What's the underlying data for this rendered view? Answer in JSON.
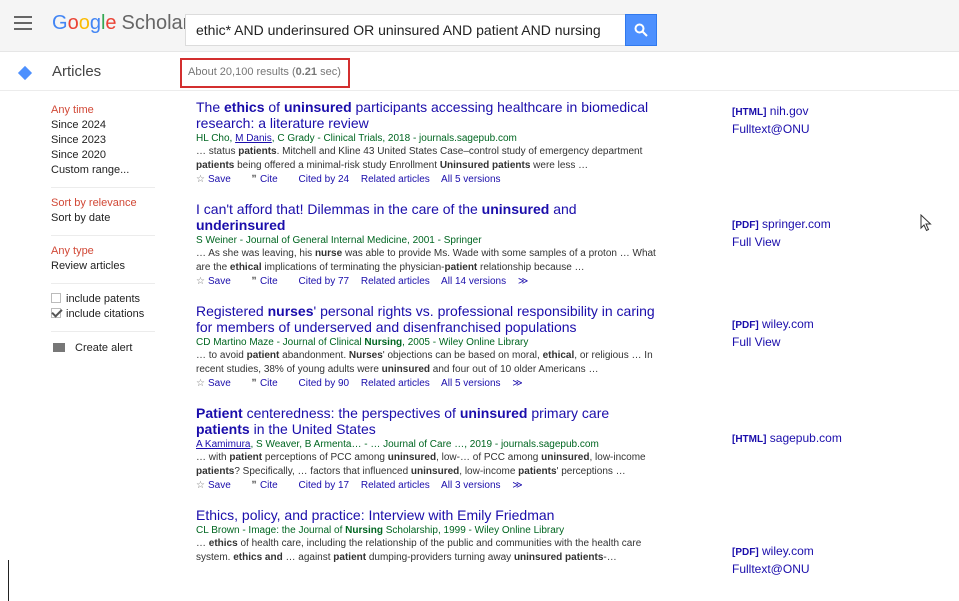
{
  "header": {
    "logo_letters": [
      "G",
      "o",
      "o",
      "g",
      "l",
      "e"
    ],
    "logo_word2": "Scholar",
    "search_value": "ethic* AND underinsured OR uninsured AND patient AND nursing"
  },
  "subbar": {
    "section": "Articles",
    "stats_prefix": "About 20,100 results (",
    "stats_time": "0.21",
    "stats_suffix": " sec)"
  },
  "sidebar": {
    "time": [
      "Any time",
      "Since 2024",
      "Since 2023",
      "Since 2020",
      "Custom range..."
    ],
    "sort": [
      "Sort by relevance",
      "Sort by date"
    ],
    "type": [
      "Any type",
      "Review articles"
    ],
    "include_patents": "include patents",
    "include_citations": "include citations",
    "create_alert": "Create alert"
  },
  "results": [
    {
      "title_html": "The <b>ethics</b> of <b>uninsured</b> participants accessing healthcare in biomedical research: a literature review",
      "authors_html": "HL Cho, <u>M Danis</u>, C Grady - Clinical Trials, 2018 - journals.sagepub.com",
      "snippet_html": "… status <b>patients</b>. Mitchell and Kline 43 United States Case–control study of emergency department <b>patients</b> being offered a minimal-risk study Enrollment <b>Uninsured patients</b> were less …",
      "save": "Save",
      "cite": "Cite",
      "cited_by": "Cited by 24",
      "related": "Related articles",
      "versions": "All 5 versions",
      "extra": ""
    },
    {
      "title_html": "I can't afford that! Dilemmas in the care of the <b>uninsured</b> and <b>underinsured</b>",
      "authors_html": "S Weiner - Journal of General Internal Medicine, 2001 - Springer",
      "snippet_html": "… As she was leaving, his <b>nurse</b> was able to provide Ms. Wade with some samples of a proton … What are the <b>ethical</b> implications of terminating the physician-<b>patient</b> relationship because …",
      "save": "Save",
      "cite": "Cite",
      "cited_by": "Cited by 77",
      "related": "Related articles",
      "versions": "All 14 versions",
      "extra": "≫"
    },
    {
      "title_html": "Registered <b>nurses</b>' personal rights vs. professional responsibility in caring for members of underserved and disenfranchised populations",
      "authors_html": "CD Martino Maze - Journal of Clinical <b>Nursing</b>, 2005 - Wiley Online Library",
      "snippet_html": "… to avoid <b>patient</b> abandonment. <b>Nurses</b>' objections can be based on moral, <b>ethical</b>, or religious … In recent studies, 38% of young adults were <b>uninsured</b> and four out of 10 older Americans …",
      "save": "Save",
      "cite": "Cite",
      "cited_by": "Cited by 90",
      "related": "Related articles",
      "versions": "All 5 versions",
      "extra": "≫"
    },
    {
      "title_html": "<b>Patient</b> centeredness: the perspectives of <b>uninsured</b> primary care <b>patients</b> in the United States",
      "authors_html": "<u>A Kamimura</u>, S Weaver, B Armenta… - … Journal of Care …, 2019 - journals.sagepub.com",
      "snippet_html": "… with <b>patient</b> perceptions of PCC among <b>uninsured</b>, low-… of PCC among <b>uninsured</b>, low-income <b>patients</b>? Specifically, … factors that influenced <b>uninsured</b>, low-income <b>patients</b>' perceptions …",
      "save": "Save",
      "cite": "Cite",
      "cited_by": "Cited by 17",
      "related": "Related articles",
      "versions": "All 3 versions",
      "extra": "≫"
    },
    {
      "title_html": "Ethics, policy, and practice: Interview with Emily Friedman",
      "authors_html": "CL Brown - Image: the Journal of <b>Nursing</b> Scholarship, 1999 - Wiley Online Library",
      "snippet_html": "… <b>ethics</b> of health care, including the relationship of the public and communities with the health care system. <b>ethics and</b> … against <b>patient</b> dumping-providers turning away <b>uninsured patients</b>-…",
      "save": "",
      "cite": "",
      "cited_by": "",
      "related": "",
      "versions": "",
      "extra": ""
    }
  ],
  "side_links": [
    {
      "tag": "[HTML]",
      "source": "nih.gov",
      "second": "Fulltext@ONU"
    },
    {
      "tag": "[PDF]",
      "source": "springer.com",
      "second": "Full View"
    },
    {
      "tag": "[PDF]",
      "source": "wiley.com",
      "second": "Full View"
    },
    {
      "tag": "[HTML]",
      "source": "sagepub.com",
      "second": ""
    },
    {
      "tag": "[PDF]",
      "source": "wiley.com",
      "second": "Fulltext@ONU"
    }
  ]
}
